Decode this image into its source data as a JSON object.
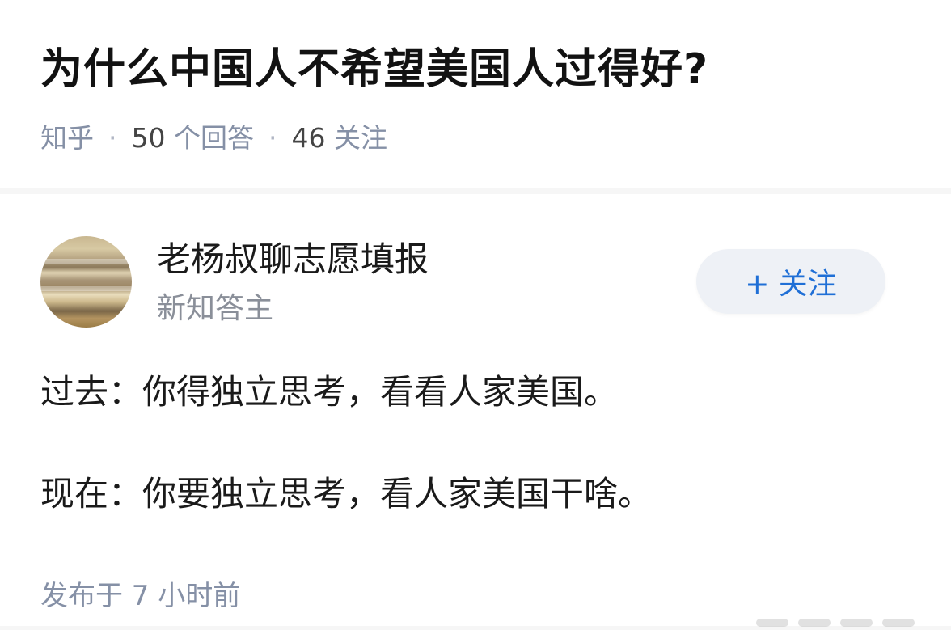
{
  "question": {
    "title": "为什么中国人不希望美国人过得好?",
    "source": "知乎",
    "answers_count": "50",
    "answers_label": "个回答",
    "followers_count": "46",
    "followers_label": "关注"
  },
  "answer": {
    "author_name": "老杨叔聊志愿填报",
    "author_badge": "新知答主",
    "follow_button_label": "+ 关注",
    "content": [
      "过去：你得独立思考，看看人家美国。",
      "现在：你要独立思考，看人家美国干啥。"
    ],
    "published_label": "发布于 7 小时前"
  },
  "colors": {
    "accent": "#1f6fd6",
    "meta_text": "#8590a6",
    "title_text": "#121212",
    "follow_bg": "#eef1f6"
  }
}
